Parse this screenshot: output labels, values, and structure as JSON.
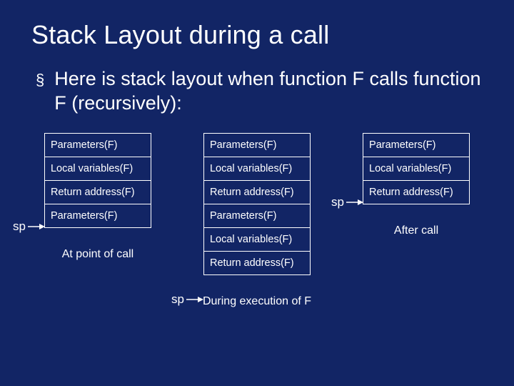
{
  "title": "Stack Layout during a call",
  "bullet_text": "Here is stack layout when function F calls function F (recursively):",
  "sp_label": "sp",
  "columns": [
    {
      "cells": [
        "Parameters(F)",
        "Local variables(F)",
        "Return address(F)",
        "Parameters(F)"
      ],
      "caption": "At point of call"
    },
    {
      "cells": [
        "Parameters(F)",
        "Local variables(F)",
        "Return address(F)",
        "Parameters(F)",
        "Local variables(F)",
        "Return address(F)"
      ],
      "caption": "During execution of F"
    },
    {
      "cells": [
        "Parameters(F)",
        "Local variables(F)",
        "Return address(F)"
      ],
      "caption": "After call"
    }
  ]
}
